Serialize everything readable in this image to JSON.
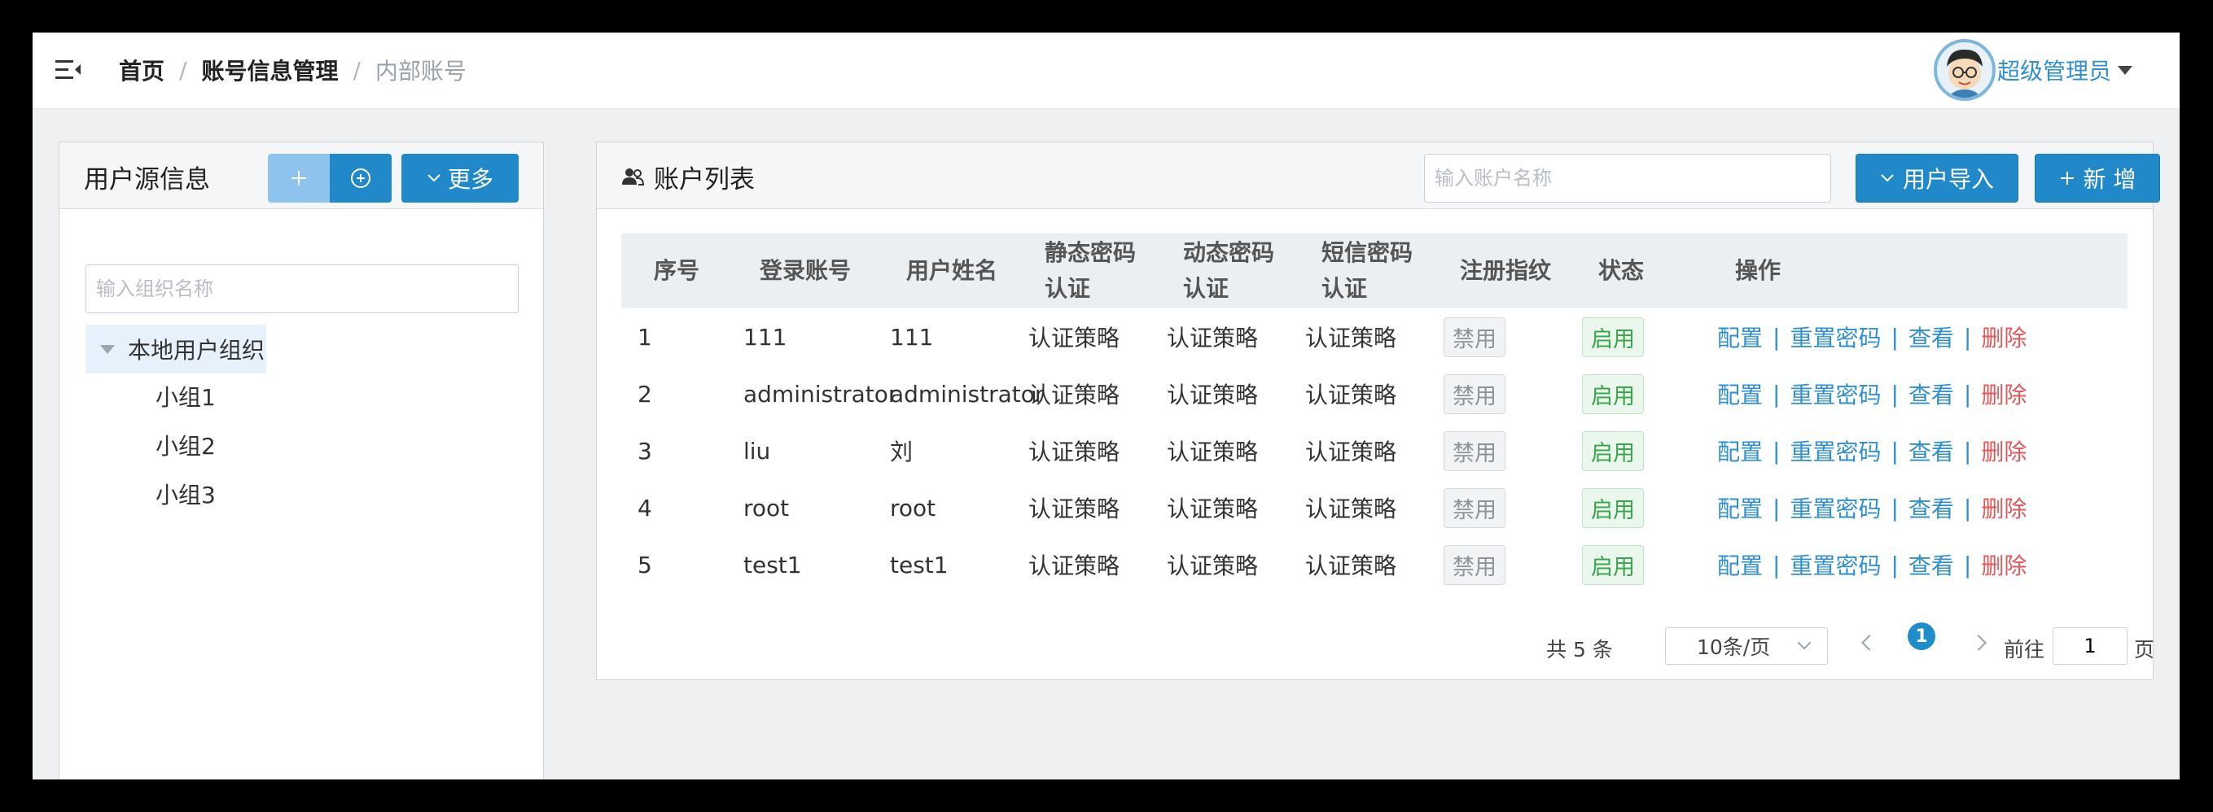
{
  "header": {
    "breadcrumb": [
      "首页",
      "账号信息管理",
      "内部账号"
    ],
    "separator": "/",
    "user_name": "超级管理员"
  },
  "left_panel": {
    "title": "用户源信息",
    "add_icon": "plus-icon",
    "circle_add_icon": "circle-plus-icon",
    "more_label": "更多",
    "search_placeholder": "输入组织名称",
    "tree": {
      "root": "本地用户组织",
      "children": [
        "小组1",
        "小组2",
        "小组3"
      ]
    }
  },
  "right_panel": {
    "title": "账户列表",
    "search_placeholder": "输入账户名称",
    "import_label": "用户导入",
    "new_label": "新 增"
  },
  "table": {
    "headers": {
      "index": "序号",
      "account": "登录账号",
      "name": "用户姓名",
      "static_pwd_1": "静态密码",
      "static_pwd_2": "认证",
      "dynamic_pwd_1": "动态密码",
      "dynamic_pwd_2": "认证",
      "sms_pwd_1": "短信密码",
      "sms_pwd_2": "认证",
      "fingerprint": "注册指纹",
      "status": "状态",
      "actions": "操作"
    },
    "rows": [
      {
        "index": "1",
        "account": "111",
        "name": "111",
        "static": "认证策略",
        "dynamic": "认证策略",
        "sms": "认证策略",
        "fingerprint": "禁用",
        "status": "启用"
      },
      {
        "index": "2",
        "account": "administrator",
        "name": "administrator",
        "static": "认证策略",
        "dynamic": "认证策略",
        "sms": "认证策略",
        "fingerprint": "禁用",
        "status": "启用"
      },
      {
        "index": "3",
        "account": "liu",
        "name": "刘",
        "static": "认证策略",
        "dynamic": "认证策略",
        "sms": "认证策略",
        "fingerprint": "禁用",
        "status": "启用"
      },
      {
        "index": "4",
        "account": "root",
        "name": "root",
        "static": "认证策略",
        "dynamic": "认证策略",
        "sms": "认证策略",
        "fingerprint": "禁用",
        "status": "启用"
      },
      {
        "index": "5",
        "account": "test1",
        "name": "test1",
        "static": "认证策略",
        "dynamic": "认证策略",
        "sms": "认证策略",
        "fingerprint": "禁用",
        "status": "启用"
      }
    ],
    "actions": {
      "config": "配置",
      "reset": "重置密码",
      "view": "查看",
      "delete": "删除",
      "sep": "|"
    }
  },
  "pagination": {
    "total": "共 5 条",
    "page_size": "10条/页",
    "current_page": "1",
    "goto_label": "前往",
    "goto_value": "1",
    "page_suffix": "页"
  },
  "colors": {
    "primary": "#2189c9",
    "link": "#2f8fcf",
    "danger": "#e0585a",
    "success": "#3aa44b"
  }
}
